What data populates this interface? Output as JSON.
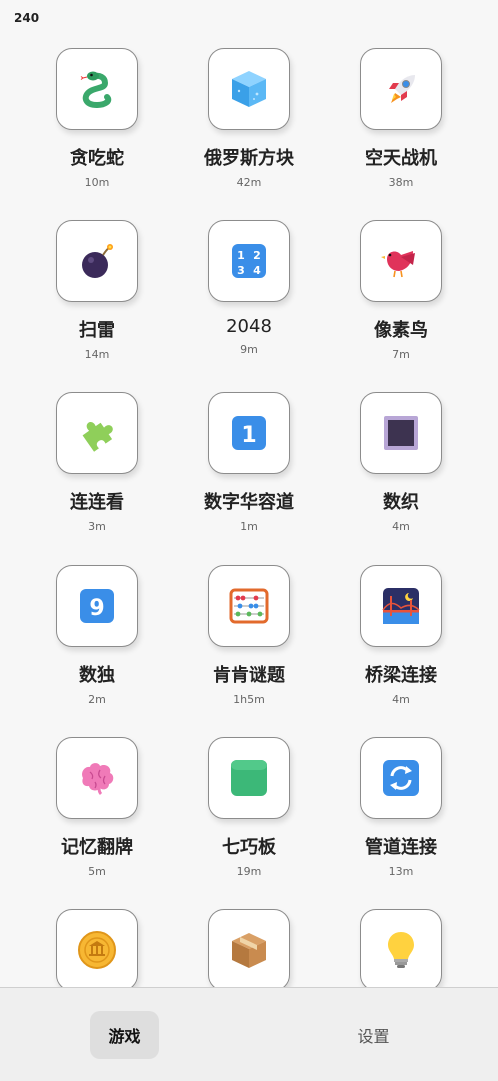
{
  "status": {
    "number": "240"
  },
  "games": [
    {
      "name": "贪吃蛇",
      "time": "10m",
      "icon": "snake-icon"
    },
    {
      "name": "俄罗斯方块",
      "time": "42m",
      "icon": "ice-cube-icon"
    },
    {
      "name": "空天战机",
      "time": "38m",
      "icon": "rocket-icon"
    },
    {
      "name": "扫雷",
      "time": "14m",
      "icon": "bomb-icon"
    },
    {
      "name": "2048",
      "time": "9m",
      "icon": "number-keypad-icon"
    },
    {
      "name": "像素鸟",
      "time": "7m",
      "icon": "bird-icon"
    },
    {
      "name": "连连看",
      "time": "3m",
      "icon": "puzzle-piece-icon"
    },
    {
      "name": "数字华容道",
      "time": "1m",
      "icon": "number-one-icon"
    },
    {
      "name": "数织",
      "time": "4m",
      "icon": "square-icon"
    },
    {
      "name": "数独",
      "time": "2m",
      "icon": "number-nine-icon"
    },
    {
      "name": "肯肯谜题",
      "time": "1h5m",
      "icon": "abacus-icon"
    },
    {
      "name": "桥梁连接",
      "time": "4m",
      "icon": "bridge-at-night-icon"
    },
    {
      "name": "记忆翻牌",
      "time": "5m",
      "icon": "brain-icon"
    },
    {
      "name": "七巧板",
      "time": "19m",
      "icon": "green-square-icon"
    },
    {
      "name": "管道连接",
      "time": "13m",
      "icon": "repeat-arrows-icon"
    },
    {
      "name": "",
      "time": "",
      "icon": "coin-icon"
    },
    {
      "name": "",
      "time": "",
      "icon": "package-icon"
    },
    {
      "name": "",
      "time": "",
      "icon": "light-bulb-icon"
    }
  ],
  "nav": {
    "games_label": "游戏",
    "settings_label": "设置"
  }
}
